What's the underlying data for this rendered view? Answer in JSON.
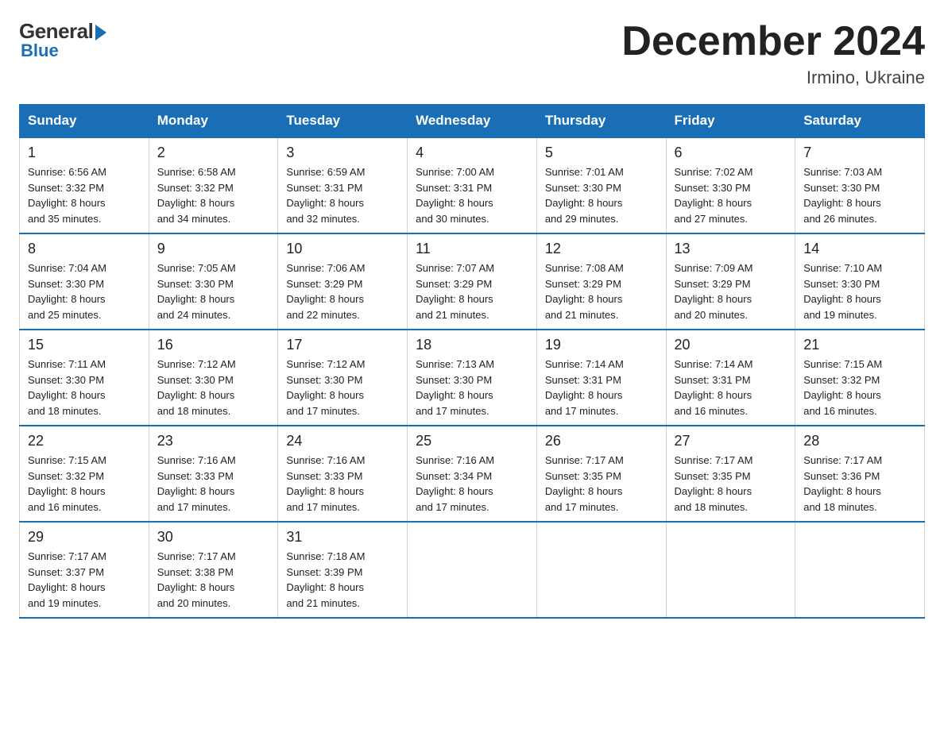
{
  "header": {
    "logo_general": "General",
    "logo_blue": "Blue",
    "month_year": "December 2024",
    "location": "Irmino, Ukraine"
  },
  "days_of_week": [
    "Sunday",
    "Monday",
    "Tuesday",
    "Wednesday",
    "Thursday",
    "Friday",
    "Saturday"
  ],
  "weeks": [
    [
      {
        "num": "1",
        "sunrise": "6:56 AM",
        "sunset": "3:32 PM",
        "daylight": "8 hours and 35 minutes."
      },
      {
        "num": "2",
        "sunrise": "6:58 AM",
        "sunset": "3:32 PM",
        "daylight": "8 hours and 34 minutes."
      },
      {
        "num": "3",
        "sunrise": "6:59 AM",
        "sunset": "3:31 PM",
        "daylight": "8 hours and 32 minutes."
      },
      {
        "num": "4",
        "sunrise": "7:00 AM",
        "sunset": "3:31 PM",
        "daylight": "8 hours and 30 minutes."
      },
      {
        "num": "5",
        "sunrise": "7:01 AM",
        "sunset": "3:30 PM",
        "daylight": "8 hours and 29 minutes."
      },
      {
        "num": "6",
        "sunrise": "7:02 AM",
        "sunset": "3:30 PM",
        "daylight": "8 hours and 27 minutes."
      },
      {
        "num": "7",
        "sunrise": "7:03 AM",
        "sunset": "3:30 PM",
        "daylight": "8 hours and 26 minutes."
      }
    ],
    [
      {
        "num": "8",
        "sunrise": "7:04 AM",
        "sunset": "3:30 PM",
        "daylight": "8 hours and 25 minutes."
      },
      {
        "num": "9",
        "sunrise": "7:05 AM",
        "sunset": "3:30 PM",
        "daylight": "8 hours and 24 minutes."
      },
      {
        "num": "10",
        "sunrise": "7:06 AM",
        "sunset": "3:29 PM",
        "daylight": "8 hours and 22 minutes."
      },
      {
        "num": "11",
        "sunrise": "7:07 AM",
        "sunset": "3:29 PM",
        "daylight": "8 hours and 21 minutes."
      },
      {
        "num": "12",
        "sunrise": "7:08 AM",
        "sunset": "3:29 PM",
        "daylight": "8 hours and 21 minutes."
      },
      {
        "num": "13",
        "sunrise": "7:09 AM",
        "sunset": "3:29 PM",
        "daylight": "8 hours and 20 minutes."
      },
      {
        "num": "14",
        "sunrise": "7:10 AM",
        "sunset": "3:30 PM",
        "daylight": "8 hours and 19 minutes."
      }
    ],
    [
      {
        "num": "15",
        "sunrise": "7:11 AM",
        "sunset": "3:30 PM",
        "daylight": "8 hours and 18 minutes."
      },
      {
        "num": "16",
        "sunrise": "7:12 AM",
        "sunset": "3:30 PM",
        "daylight": "8 hours and 18 minutes."
      },
      {
        "num": "17",
        "sunrise": "7:12 AM",
        "sunset": "3:30 PM",
        "daylight": "8 hours and 17 minutes."
      },
      {
        "num": "18",
        "sunrise": "7:13 AM",
        "sunset": "3:30 PM",
        "daylight": "8 hours and 17 minutes."
      },
      {
        "num": "19",
        "sunrise": "7:14 AM",
        "sunset": "3:31 PM",
        "daylight": "8 hours and 17 minutes."
      },
      {
        "num": "20",
        "sunrise": "7:14 AM",
        "sunset": "3:31 PM",
        "daylight": "8 hours and 16 minutes."
      },
      {
        "num": "21",
        "sunrise": "7:15 AM",
        "sunset": "3:32 PM",
        "daylight": "8 hours and 16 minutes."
      }
    ],
    [
      {
        "num": "22",
        "sunrise": "7:15 AM",
        "sunset": "3:32 PM",
        "daylight": "8 hours and 16 minutes."
      },
      {
        "num": "23",
        "sunrise": "7:16 AM",
        "sunset": "3:33 PM",
        "daylight": "8 hours and 17 minutes."
      },
      {
        "num": "24",
        "sunrise": "7:16 AM",
        "sunset": "3:33 PM",
        "daylight": "8 hours and 17 minutes."
      },
      {
        "num": "25",
        "sunrise": "7:16 AM",
        "sunset": "3:34 PM",
        "daylight": "8 hours and 17 minutes."
      },
      {
        "num": "26",
        "sunrise": "7:17 AM",
        "sunset": "3:35 PM",
        "daylight": "8 hours and 17 minutes."
      },
      {
        "num": "27",
        "sunrise": "7:17 AM",
        "sunset": "3:35 PM",
        "daylight": "8 hours and 18 minutes."
      },
      {
        "num": "28",
        "sunrise": "7:17 AM",
        "sunset": "3:36 PM",
        "daylight": "8 hours and 18 minutes."
      }
    ],
    [
      {
        "num": "29",
        "sunrise": "7:17 AM",
        "sunset": "3:37 PM",
        "daylight": "8 hours and 19 minutes."
      },
      {
        "num": "30",
        "sunrise": "7:17 AM",
        "sunset": "3:38 PM",
        "daylight": "8 hours and 20 minutes."
      },
      {
        "num": "31",
        "sunrise": "7:18 AM",
        "sunset": "3:39 PM",
        "daylight": "8 hours and 21 minutes."
      },
      null,
      null,
      null,
      null
    ]
  ],
  "labels": {
    "sunrise": "Sunrise:",
    "sunset": "Sunset:",
    "daylight": "Daylight:"
  }
}
